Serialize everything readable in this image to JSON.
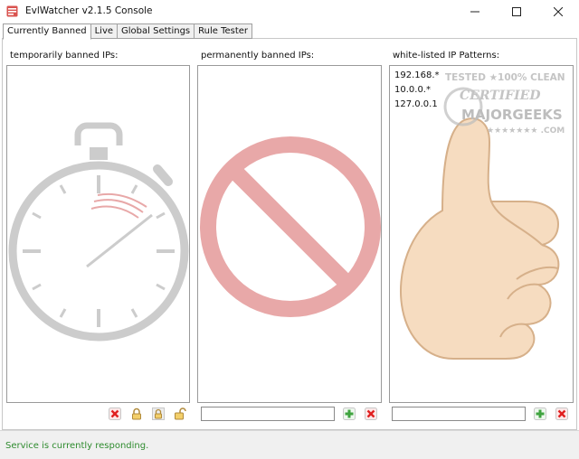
{
  "window": {
    "title": "EvlWatcher v2.1.5 Console",
    "app_icon": "app-window-icon",
    "controls": [
      "minimize-icon",
      "maximize-icon",
      "close-icon"
    ]
  },
  "tabs": [
    {
      "label": "Currently Banned",
      "active": true
    },
    {
      "label": "Live",
      "active": false
    },
    {
      "label": "Global Settings",
      "active": false
    },
    {
      "label": "Rule Tester",
      "active": false
    }
  ],
  "columns": {
    "temporary": {
      "label": "temporarily banned IPs:",
      "background_art": "stopwatch-icon",
      "buttons": [
        "remove-icon",
        "lock-icon",
        "lock-icon",
        "unlock-icon"
      ]
    },
    "permanent": {
      "label": "permanently banned IPs:",
      "background_art": "prohibited-icon",
      "input_value": "",
      "buttons": [
        "add-icon",
        "remove-icon"
      ]
    },
    "whitelist": {
      "label": "white-listed IP Patterns:",
      "background_art": "thumbs-up-icon",
      "items": [
        "192.168.*",
        "10.0.0.*",
        "127.0.0.1"
      ],
      "input_value": "",
      "buttons": [
        "add-icon",
        "remove-icon"
      ]
    }
  },
  "watermark": {
    "line1": "TESTED ★100% CLEAN",
    "line2": "CERTIFIED",
    "line3": "MAJORGEEKS",
    "line4": "★★★★★★★ .COM"
  },
  "status": {
    "text": "Service is currently responding.",
    "color": "#2e8b2e"
  },
  "colors": {
    "stopwatch": "#cccccc",
    "prohibited": "#e8a8a8",
    "thumb_fill": "#f6dcc0",
    "thumb_stroke": "#d6b08a",
    "remove": "#e02020",
    "add": "#3fa33f"
  }
}
